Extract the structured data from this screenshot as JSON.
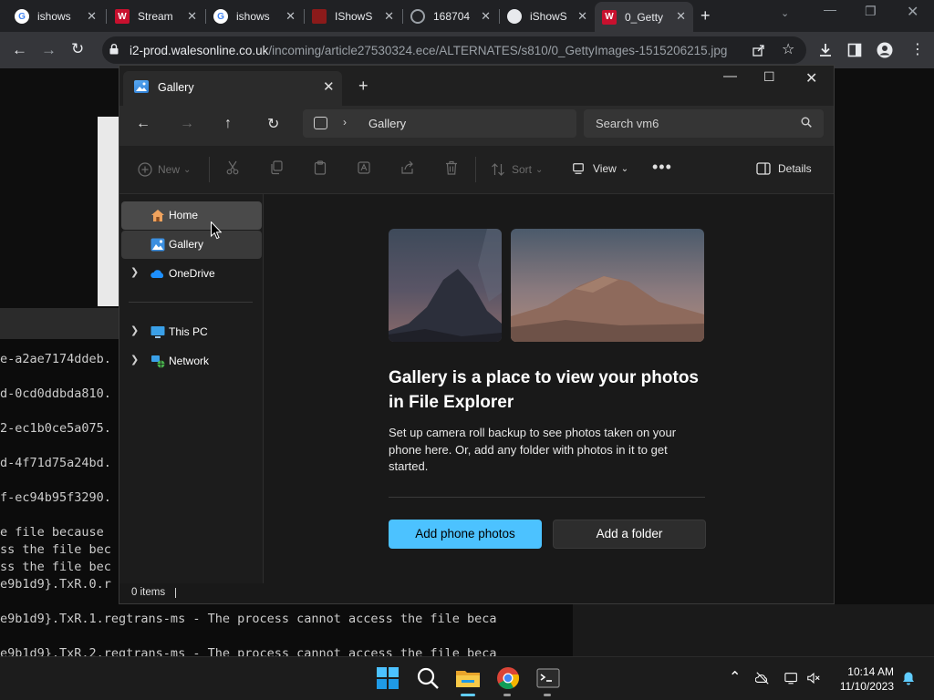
{
  "browser": {
    "tabs": [
      {
        "title": "ishows",
        "favicon": "google"
      },
      {
        "title": "Stream",
        "favicon": "w"
      },
      {
        "title": "ishows",
        "favicon": "google"
      },
      {
        "title": "IShowS",
        "favicon": "red"
      },
      {
        "title": "168704",
        "favicon": "globe"
      },
      {
        "title": "iShowS",
        "favicon": "github"
      },
      {
        "title": "0_Getty",
        "favicon": "w"
      }
    ],
    "url_host": "i2-prod.walesonline.co.uk",
    "url_path": "/incoming/article27530324.ece/ALTERNATES/s810/0_GettyImages-1515206215.jpg"
  },
  "terminal": {
    "lines": [
      "e-a2ae7174ddeb.",
      "d-0cd0ddbda810.",
      "2-ec1b0ce5a075.",
      "d-4f71d75a24bd.",
      "f-ec94b95f3290.",
      "e file because",
      "ss the file bec",
      "ss the file bec",
      "e9b1d9}.TxR.0.r",
      "e9b1d9}.TxR.1.regtrans-ms - The process cannot access the file beca",
      "e9b1d9}.TxR.2.regtrans-ms - The process cannot access the file beca"
    ]
  },
  "explorer": {
    "tab_title": "Gallery",
    "breadcrumb": "Gallery",
    "search_placeholder": "Search vm6",
    "commands": {
      "new": "New",
      "sort": "Sort",
      "view": "View",
      "details": "Details"
    },
    "nav": {
      "home": "Home",
      "gallery": "Gallery",
      "onedrive": "OneDrive",
      "this_pc": "This PC",
      "network": "Network"
    },
    "heading": "Gallery is a place to view your photos in File Explorer",
    "description": "Set up camera roll backup to see photos taken on your phone here. Or, add any folder with photos in it to get started.",
    "add_phone_label": "Add phone photos",
    "add_folder_label": "Add a folder",
    "status": "0 items",
    "accent": "#4cc2ff"
  },
  "taskbar": {
    "time": "10:14 AM",
    "date": "11/10/2023"
  }
}
